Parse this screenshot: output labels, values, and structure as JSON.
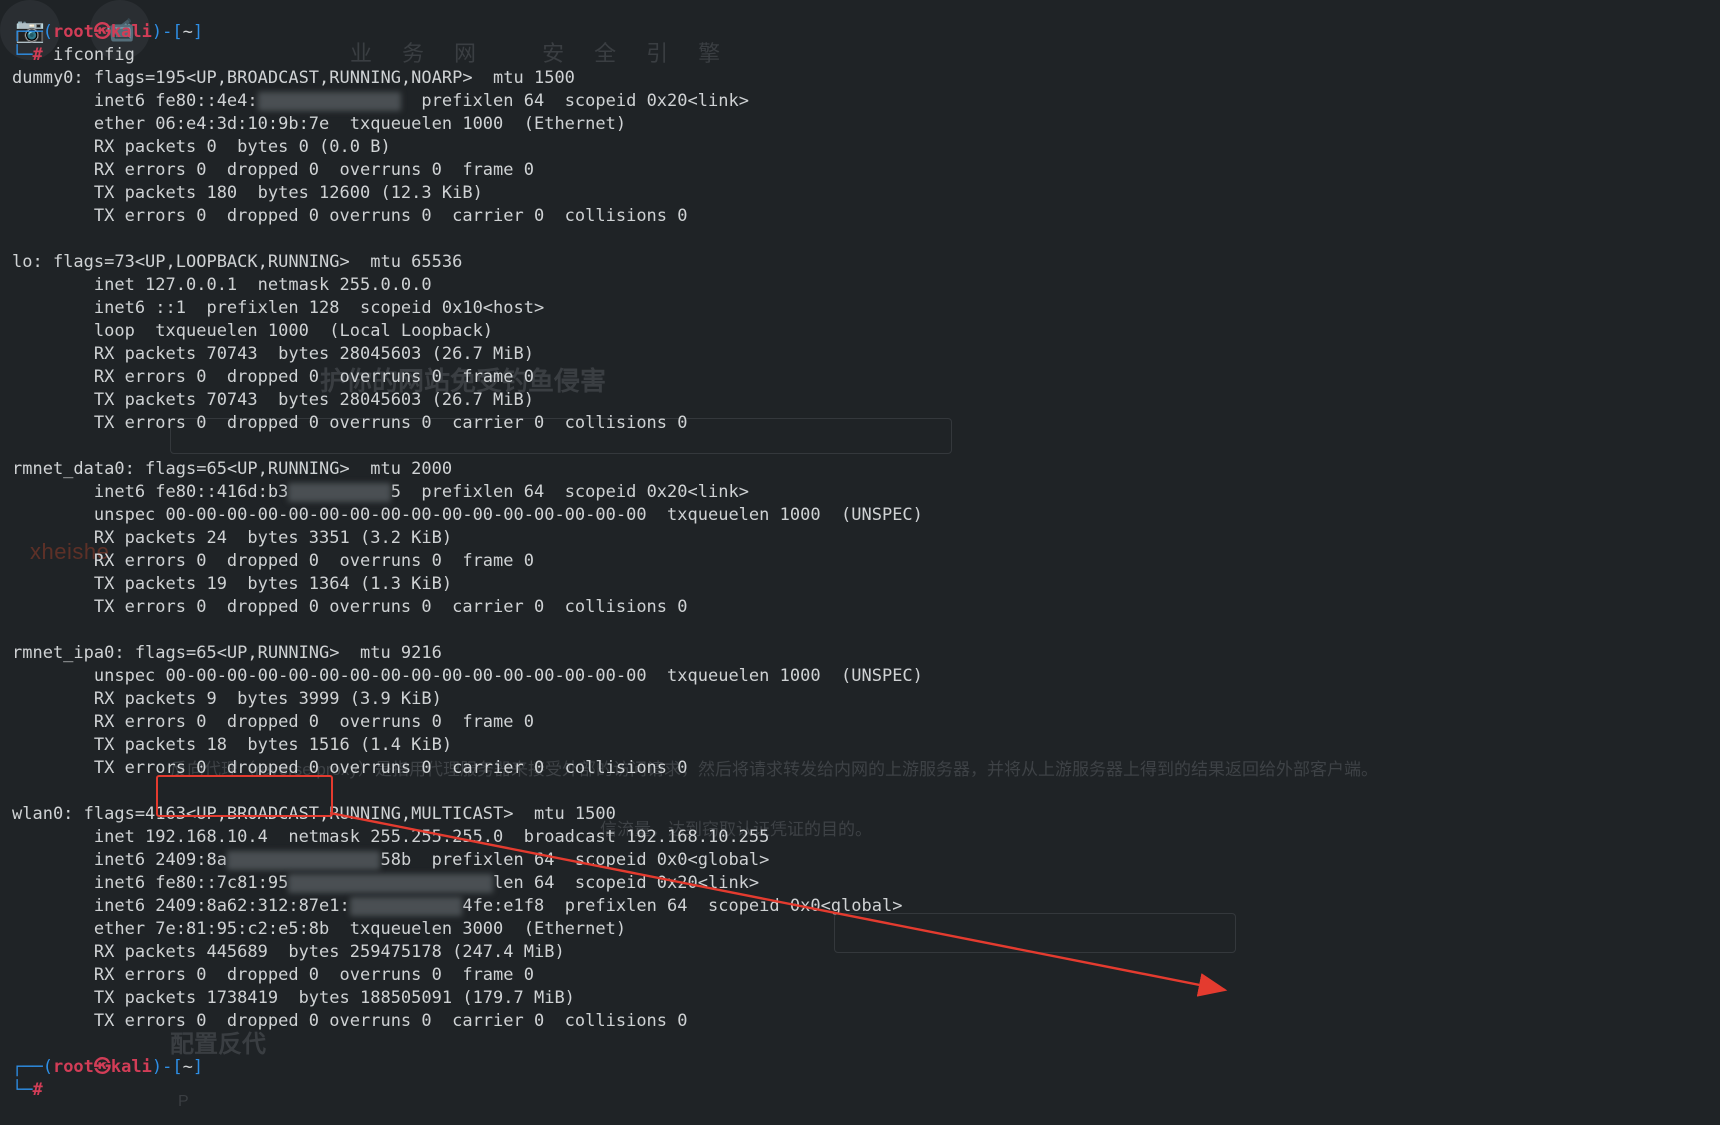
{
  "prompt1": {
    "frame_top": "┌──(",
    "user": "root",
    "at": "㉿",
    "host": "kali",
    "frame_mid": ")-[",
    "path": "~",
    "frame_end": "]",
    "frame_bottom": "└─",
    "hash": "#",
    "command": "ifconfig"
  },
  "ifconfig": {
    "dummy0": {
      "hdr": "dummy0: flags=195<UP,BROADCAST,RUNNING,NOARP>  mtu 1500",
      "l1a": "        inet6 fe80::4e4:",
      "l1b": "  prefixlen 64  scopeid 0x20<link>",
      "l2": "        ether 06:e4:3d:10:9b:7e  txqueuelen 1000  (Ethernet)",
      "l3": "        RX packets 0  bytes 0 (0.0 B)",
      "l4": "        RX errors 0  dropped 0  overruns 0  frame 0",
      "l5": "        TX packets 180  bytes 12600 (12.3 KiB)",
      "l6": "        TX errors 0  dropped 0 overruns 0  carrier 0  collisions 0"
    },
    "lo": {
      "hdr": "lo: flags=73<UP,LOOPBACK,RUNNING>  mtu 65536",
      "l1": "        inet 127.0.0.1  netmask 255.0.0.0",
      "l2": "        inet6 ::1  prefixlen 128  scopeid 0x10<host>",
      "l3": "        loop  txqueuelen 1000  (Local Loopback)",
      "l4": "        RX packets 70743  bytes 28045603 (26.7 MiB)",
      "l5": "        RX errors 0  dropped 0  overruns 0  frame 0",
      "l6": "        TX packets 70743  bytes 28045603 (26.7 MiB)",
      "l7": "        TX errors 0  dropped 0 overruns 0  carrier 0  collisions 0"
    },
    "rmnet_data0": {
      "hdr": "rmnet_data0: flags=65<UP,RUNNING>  mtu 2000",
      "l1a": "        inet6 fe80::416d:b3",
      "l1b": "5  prefixlen 64  scopeid 0x20<link>",
      "l2": "        unspec 00-00-00-00-00-00-00-00-00-00-00-00-00-00-00-00  txqueuelen 1000  (UNSPEC)",
      "l3": "        RX packets 24  bytes 3351 (3.2 KiB)",
      "l4": "        RX errors 0  dropped 0  overruns 0  frame 0",
      "l5": "        TX packets 19  bytes 1364 (1.3 KiB)",
      "l6": "        TX errors 0  dropped 0 overruns 0  carrier 0  collisions 0"
    },
    "rmnet_ipa0": {
      "hdr": "rmnet_ipa0: flags=65<UP,RUNNING>  mtu 9216",
      "l1": "        unspec 00-00-00-00-00-00-00-00-00-00-00-00-00-00-00-00  txqueuelen 1000  (UNSPEC)",
      "l2": "        RX packets 9  bytes 3999 (3.9 KiB)",
      "l3": "        RX errors 0  dropped 0  overruns 0  frame 0",
      "l4": "        TX packets 18  bytes 1516 (1.4 KiB)",
      "l5": "        TX errors 0  dropped 0 overruns 0  carrier 0  collisions 0"
    },
    "wlan0": {
      "hdr": "wlan0: flags=4163<UP,BROADCAST,RUNNING,MULTICAST>  mtu 1500",
      "l1": "        inet 192.168.10.4  netmask 255.255.255.0  broadcast 192.168.10.255",
      "l2a": "        inet6 2409:8a",
      "l2b": "58b  prefixlen 64  scopeid 0x0<global>",
      "l3a": "        inet6 fe80::7c81:95",
      "l3b": "len 64  scopeid 0x20<link>",
      "l4a": "        inet6 2409:8a62:312:87e1:",
      "l4b": "4fe:e1f8  prefixlen 64  scopeid 0x0<global>",
      "l5": "        ether 7e:81:95:c2:e5:8b  txqueuelen 3000  (Ethernet)",
      "l6": "        RX packets 445689  bytes 259475178 (247.4 MiB)",
      "l7": "        RX errors 0  dropped 0  overruns 0  frame 0",
      "l8": "        TX packets 1738419  bytes 188505091 (179.7 MiB)",
      "l9": "        TX errors 0  dropped 0 overruns 0  carrier 0  collisions 0"
    }
  },
  "prompt2": {
    "frame_top": "┌──(",
    "user": "root",
    "at": "㉿",
    "host": "kali",
    "frame_mid": ")-[",
    "path": "~",
    "frame_end": "]",
    "frame_bottom": "└─",
    "hash": "#"
  },
  "highlight_ip": "192.168.10.4",
  "watermark": "xheishe",
  "ghost": {
    "nav": "业务网  安全引擎",
    "title": "护你的网站免受钓鱼侵害",
    "para": "反向代理（reverse proxy）是指用代理服务器来接受外部的访问请求，然后将请求转发给内网的上游服务器，并将从上游服务器上得到的结果返回给外部客户端。",
    "para2": "信流量，达到窃取认证凭证的目的。",
    "h2": "配置反代",
    "p": "P"
  }
}
